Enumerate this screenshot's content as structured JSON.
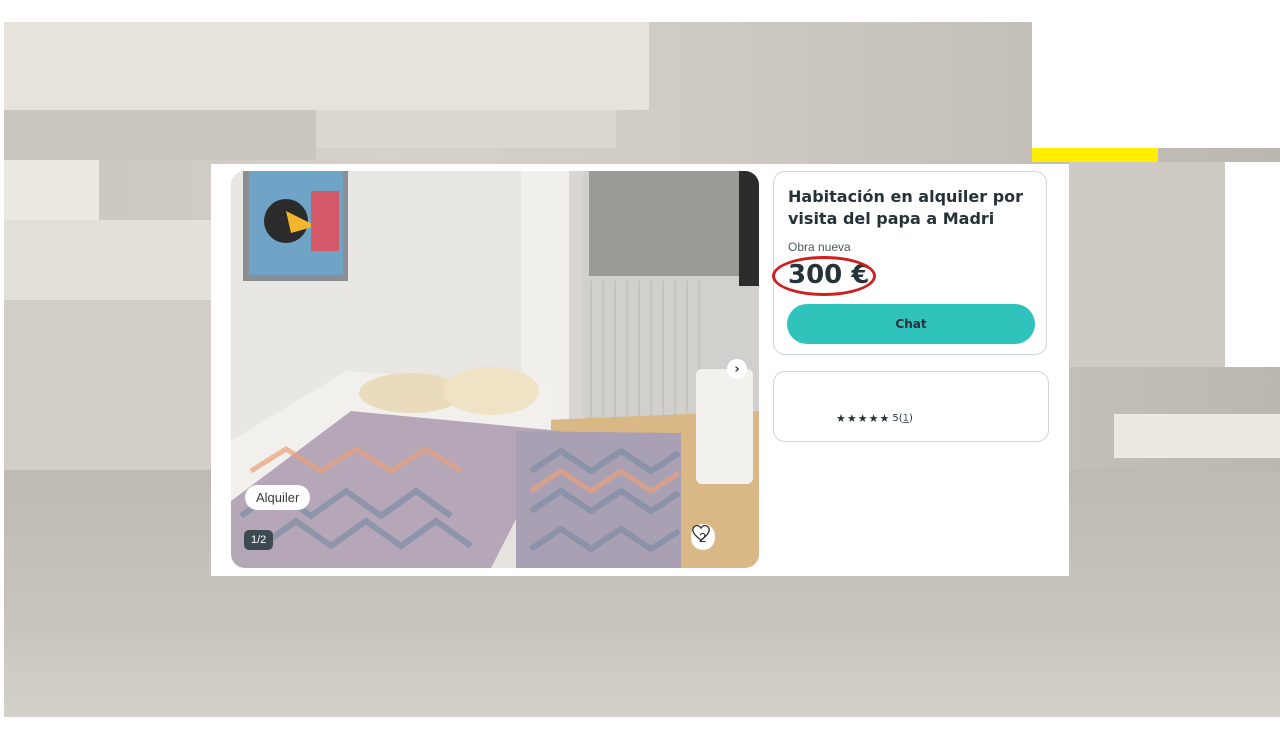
{
  "listing": {
    "title": "Habitación en alquiler por visita del papa a Madri",
    "condition": "Obra nueva",
    "price": "300 €",
    "chat_label": "Chat",
    "tag": "Alquiler",
    "photo_counter": "1/2",
    "favorites_count": "2"
  },
  "seller": {
    "stars": "★★★★★",
    "rating_value": "5",
    "reviews_count": "1"
  },
  "colors": {
    "chat_button": "#2fc3bc",
    "price_annotation": "#d11f1f",
    "title_text": "#253238"
  },
  "icons": [
    "chevron-right-icon",
    "heart-icon",
    "star-icon"
  ]
}
